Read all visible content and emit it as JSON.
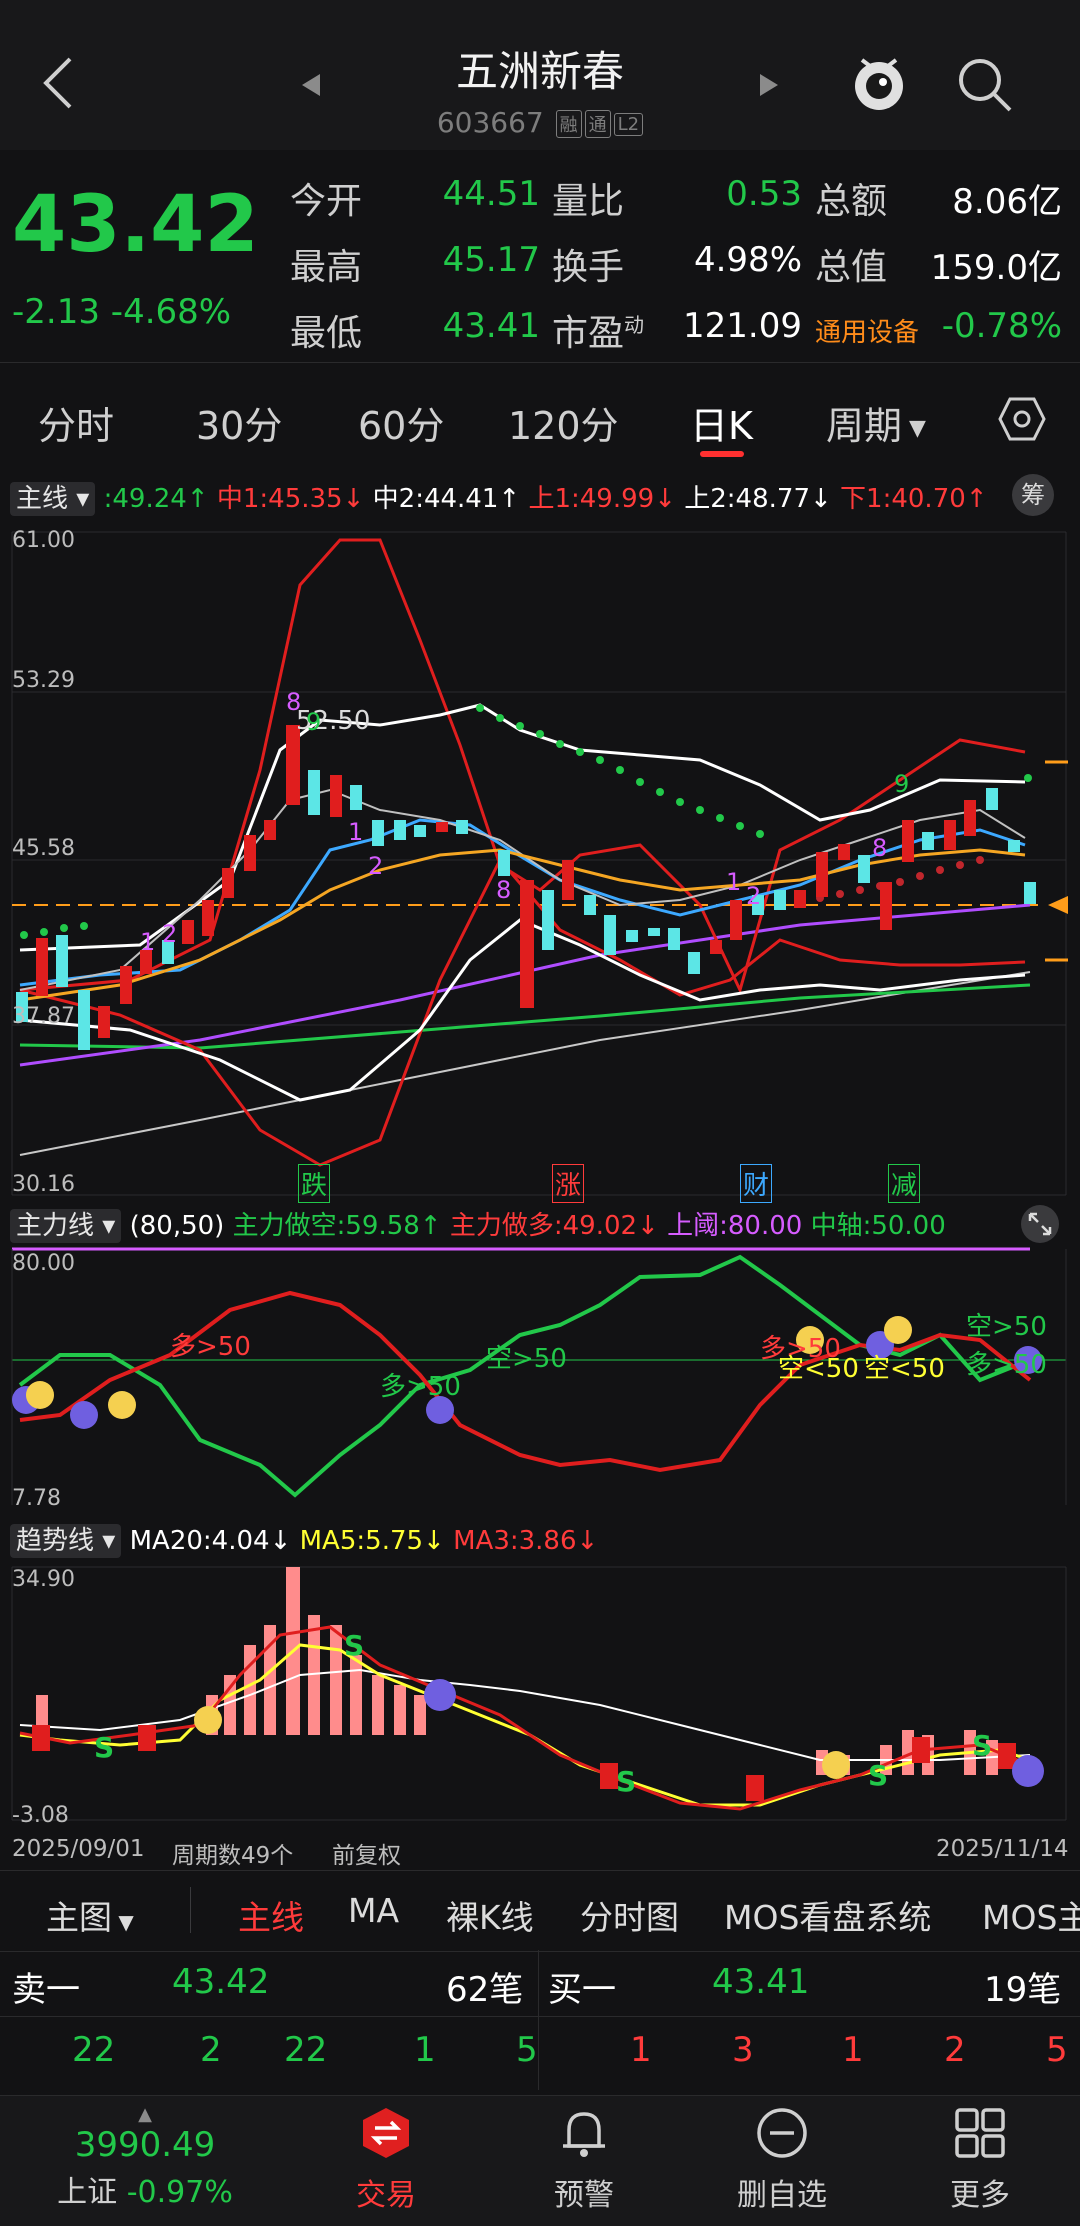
{
  "header": {
    "title": "五洲新春",
    "code": "603667",
    "tags": [
      "融",
      "通",
      "L2"
    ]
  },
  "quote": {
    "price": "43.42",
    "change": "-2.13",
    "change_pct": "-4.68%",
    "rows": [
      {
        "l1": "今开",
        "v1": "44.51",
        "l2": "量比",
        "v2": "0.53",
        "l3": "总额",
        "v3": "8.06亿"
      },
      {
        "l1": "最高",
        "v1": "45.17",
        "l2": "换手",
        "v2": "4.98%",
        "l3": "总值",
        "v3": "159.0亿"
      },
      {
        "l1": "最低",
        "v1": "43.41",
        "l2": "市盈",
        "v2": "121.09",
        "l3": "通用设备",
        "v3": "-0.78%"
      }
    ],
    "pe_sup": "动"
  },
  "tabs": [
    "分时",
    "30分",
    "60分",
    "120分",
    "日K",
    "周期"
  ],
  "main_panel": {
    "dropdown": "主线",
    "indicators": [
      {
        "text": ":49.24↑",
        "color": "#22c84a"
      },
      {
        "text": "中1:45.35↓",
        "color": "#ff3b3b"
      },
      {
        "text": "中2:44.41↑",
        "color": "#ffffff"
      },
      {
        "text": "上1:49.99↓",
        "color": "#ff3b3b"
      },
      {
        "text": "上2:48.77↓",
        "color": "#ffffff"
      },
      {
        "text": "下1:40.70↑",
        "color": "#ff3b3b"
      }
    ],
    "chip_btn": "筹",
    "y_labels": [
      "61.00",
      "53.29",
      "45.58",
      "37.87",
      "30.16"
    ],
    "peak_label": "52.50",
    "events": [
      "跌",
      "涨",
      "财",
      "减"
    ],
    "seq_labels": [
      "8",
      "9",
      "1",
      "2",
      "1",
      "2",
      "8",
      "1",
      "2",
      "9",
      "8"
    ]
  },
  "force_panel": {
    "dropdown": "主力线",
    "param": "(80,50)",
    "items": [
      {
        "text": "主力做空:59.58↑",
        "color": "#22c84a"
      },
      {
        "text": "主力做多:49.02↓",
        "color": "#ff3b3b"
      },
      {
        "text": "上阈:80.00",
        "color": "#d65cff"
      },
      {
        "text": "中轴:50.00",
        "color": "#22c84a"
      }
    ],
    "y_labels": [
      "80.00",
      "7.78"
    ],
    "annotations": [
      "多>50",
      "多>50",
      "空>50",
      "多>50",
      "空<50",
      "空<50",
      "空>50",
      "多>50"
    ]
  },
  "trend_panel": {
    "dropdown": "趋势线",
    "items": [
      {
        "text": "MA20:4.04↓",
        "color": "#ffffff"
      },
      {
        "text": "MA5:5.75↓",
        "color": "#ffff33"
      },
      {
        "text": "MA3:3.86↓",
        "color": "#ff3b3b"
      }
    ],
    "y_labels": [
      "34.90",
      "-3.08"
    ],
    "footer": {
      "start": "2025/09/01",
      "count": "周期数49个",
      "adj": "前复权",
      "end": "2025/11/14"
    }
  },
  "chart_types": [
    "主图",
    "主线",
    "MA",
    "裸K线",
    "分时图",
    "MOS看盘系统",
    "MOS主"
  ],
  "orderbook": {
    "sell1_label": "卖一",
    "sell1_price": "43.42",
    "sell1_count": "62笔",
    "buy1_label": "买一",
    "buy1_price": "43.41",
    "buy1_count": "19笔",
    "sell_vols": [
      "22",
      "2",
      "22",
      "1",
      "5"
    ],
    "buy_vols": [
      "1",
      "3",
      "1",
      "2",
      "5"
    ]
  },
  "navbar": {
    "index_value": "3990.49",
    "index_name": "上证",
    "index_change": "-0.97%",
    "items": [
      "交易",
      "预警",
      "删自选",
      "更多"
    ]
  },
  "chart_data": {
    "type": "line",
    "x": [
      "2025/09/01",
      "2025/11/14"
    ],
    "ylim": [
      30.16,
      61.0
    ],
    "series": [
      {
        "name": "上1",
        "values": [
          46,
          61,
          56,
          50,
          49.99
        ]
      },
      {
        "name": "中1",
        "values": [
          40,
          45,
          47,
          46,
          45.35
        ]
      },
      {
        "name": "下1",
        "values": [
          39,
          32,
          36,
          39,
          40.7
        ]
      }
    ]
  }
}
